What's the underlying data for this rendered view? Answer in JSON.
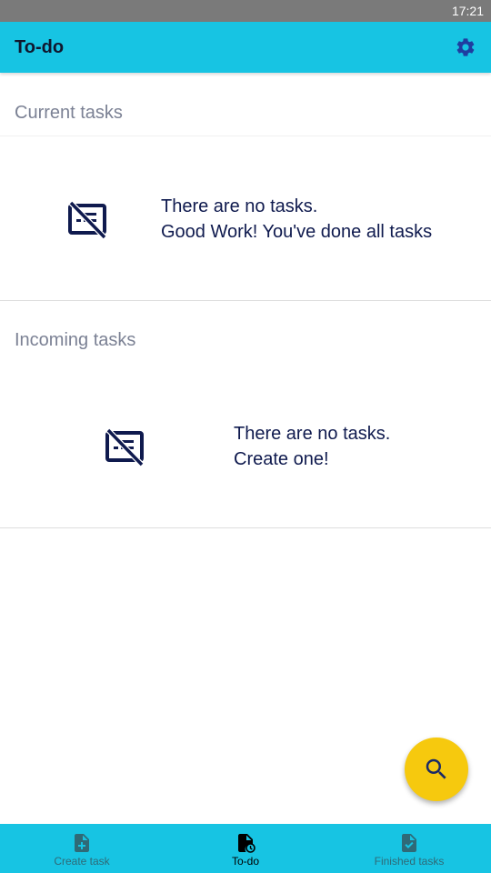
{
  "status_bar": {
    "time": "17:21"
  },
  "app_bar": {
    "title": "To-do",
    "settings_icon": "gear-icon"
  },
  "sections": [
    {
      "title": "Current tasks",
      "empty_icon": "no-tasks-icon",
      "empty_line1": "There are no tasks.",
      "empty_line2": "Good Work! You've done all tasks"
    },
    {
      "title": "Incoming tasks",
      "empty_icon": "no-tasks-icon",
      "empty_line1": "There are no tasks.",
      "empty_line2": "Create one!"
    }
  ],
  "fab": {
    "icon": "search-icon"
  },
  "bottom_nav": {
    "items": [
      {
        "label": "Create task",
        "icon": "file-plus-icon",
        "active": false
      },
      {
        "label": "To-do",
        "icon": "file-clock-icon",
        "active": true
      },
      {
        "label": "Finished tasks",
        "icon": "file-check-icon",
        "active": false
      }
    ]
  },
  "colors": {
    "app_bar": "#17c4e3",
    "status_bar": "#7a7a7a",
    "fab": "#f6c90e",
    "section_title": "#7b8194",
    "body_text": "#0f1a4e"
  }
}
